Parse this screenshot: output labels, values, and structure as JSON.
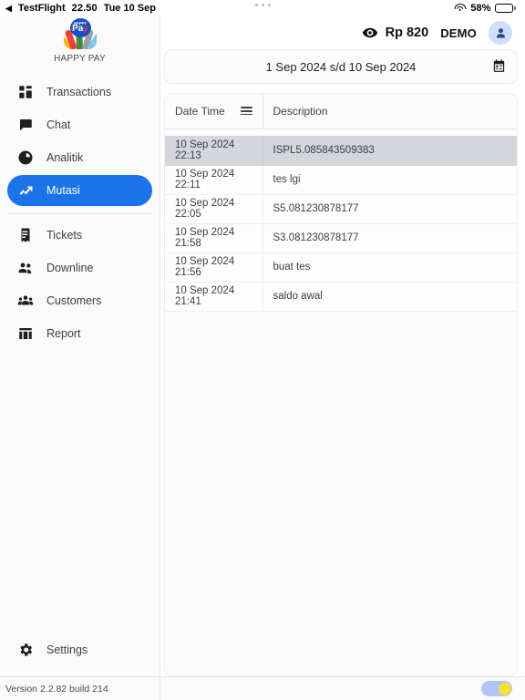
{
  "status_bar": {
    "back_app": "TestFlight",
    "back_icon": "triangle-left-icon",
    "time": "22.50",
    "date": "Tue 10 Sep",
    "wifi_icon": "wifi-icon",
    "battery_percent": "58%",
    "battery_level": 58
  },
  "sidebar": {
    "logo_icon": "happy-pay-logo",
    "logo_badge_top": "HAPPY",
    "logo_badge_main": "Pa",
    "logo_badge_accent": "y",
    "brand_name": "HAPPY PAY",
    "items": [
      {
        "label": "Transactions",
        "icon": "dashboard-grid-icon",
        "active": false
      },
      {
        "label": "Chat",
        "icon": "chat-bubble-icon",
        "active": false
      },
      {
        "label": "Analitik",
        "icon": "pie-chart-icon",
        "active": false
      },
      {
        "label": "Mutasi",
        "icon": "trend-up-icon",
        "active": true
      },
      {
        "label": "Tickets",
        "icon": "receipt-icon",
        "active": false
      },
      {
        "label": "Downline",
        "icon": "people-icon",
        "active": false
      },
      {
        "label": "Customers",
        "icon": "group-icon",
        "active": false
      },
      {
        "label": "Report",
        "icon": "table-chart-icon",
        "active": false
      }
    ],
    "settings": {
      "label": "Settings",
      "icon": "gear-icon"
    },
    "version": "Version 2.2.82 build 214"
  },
  "topbar": {
    "eye_icon": "eye-icon",
    "balance": "Rp 820",
    "account": "DEMO",
    "avatar_icon": "person-icon"
  },
  "date_range": {
    "value": "1 Sep 2024 s/d 10 Sep 2024",
    "calendar_icon": "calendar-icon"
  },
  "table": {
    "columns": [
      "Date Time",
      "Description"
    ],
    "header_menu_icon": "hamburger-menu-icon",
    "rows": [
      {
        "date_time": "10 Sep 2024 22:13",
        "description": "ISPL5.085843509383",
        "selected": true
      },
      {
        "date_time": "10 Sep 2024 22:11",
        "description": "tes lgi",
        "selected": false
      },
      {
        "date_time": "10 Sep 2024 22:05",
        "description": "S5.081230878177",
        "selected": false
      },
      {
        "date_time": "10 Sep 2024 21:58",
        "description": "S3.081230878177",
        "selected": false
      },
      {
        "date_time": "10 Sep 2024 21:56",
        "description": "buat tes",
        "selected": false
      },
      {
        "date_time": "10 Sep 2024 21:41",
        "description": "saldo awal",
        "selected": false
      }
    ]
  },
  "bottom_bar": {
    "toggle_name": "mode-toggle",
    "toggle_on": true
  },
  "colors": {
    "accent": "#1a73e8",
    "selected_row": "#d4d6db",
    "toggle_track": "#aec5f5",
    "toggle_knob": "#f2e235",
    "avatar_bg": "#cfdffb"
  }
}
